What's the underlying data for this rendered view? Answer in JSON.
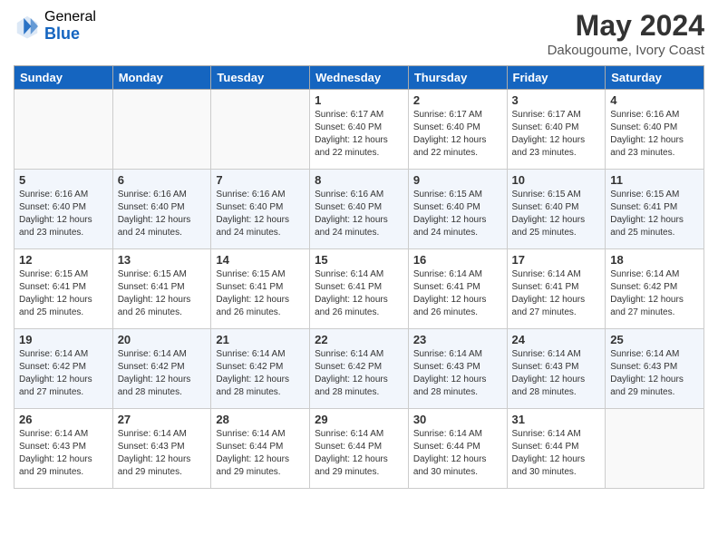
{
  "header": {
    "logo_general": "General",
    "logo_blue": "Blue",
    "title": "May 2024",
    "subtitle": "Dakougoume, Ivory Coast"
  },
  "weekdays": [
    "Sunday",
    "Monday",
    "Tuesday",
    "Wednesday",
    "Thursday",
    "Friday",
    "Saturday"
  ],
  "weeks": [
    [
      {
        "day": "",
        "info": "",
        "empty": true
      },
      {
        "day": "",
        "info": "",
        "empty": true
      },
      {
        "day": "",
        "info": "",
        "empty": true
      },
      {
        "day": "1",
        "info": "Sunrise: 6:17 AM\nSunset: 6:40 PM\nDaylight: 12 hours\nand 22 minutes.",
        "empty": false
      },
      {
        "day": "2",
        "info": "Sunrise: 6:17 AM\nSunset: 6:40 PM\nDaylight: 12 hours\nand 22 minutes.",
        "empty": false
      },
      {
        "day": "3",
        "info": "Sunrise: 6:17 AM\nSunset: 6:40 PM\nDaylight: 12 hours\nand 23 minutes.",
        "empty": false
      },
      {
        "day": "4",
        "info": "Sunrise: 6:16 AM\nSunset: 6:40 PM\nDaylight: 12 hours\nand 23 minutes.",
        "empty": false
      }
    ],
    [
      {
        "day": "5",
        "info": "Sunrise: 6:16 AM\nSunset: 6:40 PM\nDaylight: 12 hours\nand 23 minutes.",
        "empty": false
      },
      {
        "day": "6",
        "info": "Sunrise: 6:16 AM\nSunset: 6:40 PM\nDaylight: 12 hours\nand 24 minutes.",
        "empty": false
      },
      {
        "day": "7",
        "info": "Sunrise: 6:16 AM\nSunset: 6:40 PM\nDaylight: 12 hours\nand 24 minutes.",
        "empty": false
      },
      {
        "day": "8",
        "info": "Sunrise: 6:16 AM\nSunset: 6:40 PM\nDaylight: 12 hours\nand 24 minutes.",
        "empty": false
      },
      {
        "day": "9",
        "info": "Sunrise: 6:15 AM\nSunset: 6:40 PM\nDaylight: 12 hours\nand 24 minutes.",
        "empty": false
      },
      {
        "day": "10",
        "info": "Sunrise: 6:15 AM\nSunset: 6:40 PM\nDaylight: 12 hours\nand 25 minutes.",
        "empty": false
      },
      {
        "day": "11",
        "info": "Sunrise: 6:15 AM\nSunset: 6:41 PM\nDaylight: 12 hours\nand 25 minutes.",
        "empty": false
      }
    ],
    [
      {
        "day": "12",
        "info": "Sunrise: 6:15 AM\nSunset: 6:41 PM\nDaylight: 12 hours\nand 25 minutes.",
        "empty": false
      },
      {
        "day": "13",
        "info": "Sunrise: 6:15 AM\nSunset: 6:41 PM\nDaylight: 12 hours\nand 26 minutes.",
        "empty": false
      },
      {
        "day": "14",
        "info": "Sunrise: 6:15 AM\nSunset: 6:41 PM\nDaylight: 12 hours\nand 26 minutes.",
        "empty": false
      },
      {
        "day": "15",
        "info": "Sunrise: 6:14 AM\nSunset: 6:41 PM\nDaylight: 12 hours\nand 26 minutes.",
        "empty": false
      },
      {
        "day": "16",
        "info": "Sunrise: 6:14 AM\nSunset: 6:41 PM\nDaylight: 12 hours\nand 26 minutes.",
        "empty": false
      },
      {
        "day": "17",
        "info": "Sunrise: 6:14 AM\nSunset: 6:41 PM\nDaylight: 12 hours\nand 27 minutes.",
        "empty": false
      },
      {
        "day": "18",
        "info": "Sunrise: 6:14 AM\nSunset: 6:42 PM\nDaylight: 12 hours\nand 27 minutes.",
        "empty": false
      }
    ],
    [
      {
        "day": "19",
        "info": "Sunrise: 6:14 AM\nSunset: 6:42 PM\nDaylight: 12 hours\nand 27 minutes.",
        "empty": false
      },
      {
        "day": "20",
        "info": "Sunrise: 6:14 AM\nSunset: 6:42 PM\nDaylight: 12 hours\nand 28 minutes.",
        "empty": false
      },
      {
        "day": "21",
        "info": "Sunrise: 6:14 AM\nSunset: 6:42 PM\nDaylight: 12 hours\nand 28 minutes.",
        "empty": false
      },
      {
        "day": "22",
        "info": "Sunrise: 6:14 AM\nSunset: 6:42 PM\nDaylight: 12 hours\nand 28 minutes.",
        "empty": false
      },
      {
        "day": "23",
        "info": "Sunrise: 6:14 AM\nSunset: 6:43 PM\nDaylight: 12 hours\nand 28 minutes.",
        "empty": false
      },
      {
        "day": "24",
        "info": "Sunrise: 6:14 AM\nSunset: 6:43 PM\nDaylight: 12 hours\nand 28 minutes.",
        "empty": false
      },
      {
        "day": "25",
        "info": "Sunrise: 6:14 AM\nSunset: 6:43 PM\nDaylight: 12 hours\nand 29 minutes.",
        "empty": false
      }
    ],
    [
      {
        "day": "26",
        "info": "Sunrise: 6:14 AM\nSunset: 6:43 PM\nDaylight: 12 hours\nand 29 minutes.",
        "empty": false
      },
      {
        "day": "27",
        "info": "Sunrise: 6:14 AM\nSunset: 6:43 PM\nDaylight: 12 hours\nand 29 minutes.",
        "empty": false
      },
      {
        "day": "28",
        "info": "Sunrise: 6:14 AM\nSunset: 6:44 PM\nDaylight: 12 hours\nand 29 minutes.",
        "empty": false
      },
      {
        "day": "29",
        "info": "Sunrise: 6:14 AM\nSunset: 6:44 PM\nDaylight: 12 hours\nand 29 minutes.",
        "empty": false
      },
      {
        "day": "30",
        "info": "Sunrise: 6:14 AM\nSunset: 6:44 PM\nDaylight: 12 hours\nand 30 minutes.",
        "empty": false
      },
      {
        "day": "31",
        "info": "Sunrise: 6:14 AM\nSunset: 6:44 PM\nDaylight: 12 hours\nand 30 minutes.",
        "empty": false
      },
      {
        "day": "",
        "info": "",
        "empty": true
      }
    ]
  ]
}
